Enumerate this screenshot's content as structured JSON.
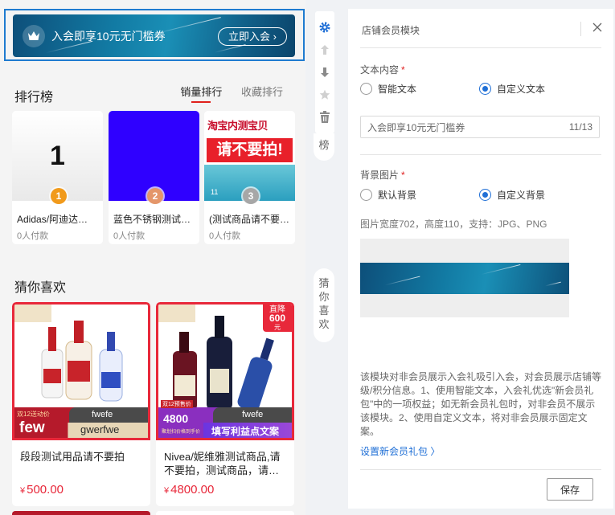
{
  "banner": {
    "text": "入会即享10元无门槛券",
    "button": "立即入会 ›"
  },
  "ranking": {
    "title": "排行榜",
    "tabs": [
      "销量排行",
      "收藏排行"
    ],
    "items": [
      {
        "rank": "1",
        "name": "Adidas/阿迪达…",
        "sales": "0人付款",
        "medal_color": "#f19a1b",
        "image_text": "1"
      },
      {
        "rank": "2",
        "name": "蓝色不锈钢测试…",
        "sales": "0人付款",
        "medal_color": "#e4966a",
        "image_color": "#2f00ff"
      },
      {
        "rank": "3",
        "name": "(测试商品请不要…",
        "sales": "0人付款",
        "medal_color": "#a7a7a7",
        "image_top": "淘宝内测宝贝",
        "image_main": "请不要拍!",
        "image_badge": "11"
      }
    ]
  },
  "guess": {
    "title": "猜你喜欢",
    "items": [
      {
        "name": "段段测试用品请不要拍",
        "price": "500.00",
        "currency": "¥",
        "tag_top": "双12送动价",
        "tag_main": "few",
        "shop": "fwefe",
        "shop_sub": "gwerfwe"
      },
      {
        "name": "Nivea/妮维雅测试商品,请不要拍，测试商品，请…",
        "price": "4800.00",
        "currency": "¥",
        "corner_badge": "直降",
        "corner_value": "600",
        "corner_unit": "元",
        "tag_top": "双12预售价",
        "tag_main": "4800",
        "tag_sub": "聚划扫价格到手价",
        "shop": "fwefe",
        "shop_sub": "填写利益点文案"
      }
    ]
  },
  "side_labels": {
    "rank": "榜",
    "guess": "猜你喜欢"
  },
  "panel": {
    "title": "店铺会员模块",
    "text_content": {
      "label": "文本内容",
      "required": "*",
      "options": [
        "智能文本",
        "自定义文本"
      ],
      "selected": "自定义文本",
      "input_value": "入会即享10元无门槛券",
      "counter": "11/13"
    },
    "background": {
      "label": "背景图片",
      "required": "*",
      "options": [
        "默认背景",
        "自定义背景"
      ],
      "selected": "自定义背景",
      "hint": "图片宽度702，高度110，支持：JPG、PNG"
    },
    "description": "该模块对非会员展示入会礼吸引入会，对会员展示店铺等级/积分信息。1、使用智能文本，入会礼优选\"新会员礼包\"中的一项权益；如无新会员礼包时，对非会员不展示该模块。2、使用自定义文本，将对非会员展示固定文案。",
    "link": "设置新会员礼包 〉",
    "save": "保存"
  },
  "colors": {
    "accent": "#1f6fd6",
    "price": "#e8283a",
    "required": "#e02020"
  }
}
